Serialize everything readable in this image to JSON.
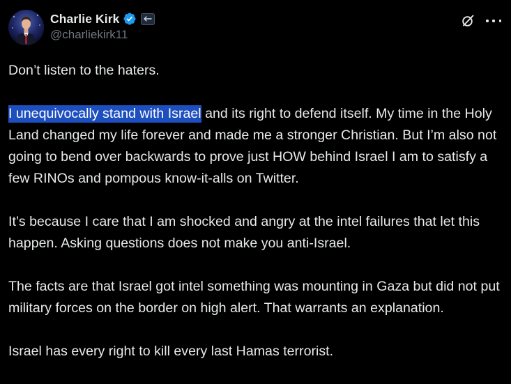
{
  "author": {
    "display_name": "Charlie Kirk",
    "handle": "@charliekirk11",
    "verified": true,
    "avatar_icon": "profile-photo",
    "badge_icon": "affiliate-badge"
  },
  "header_actions": {
    "grok_icon": "grok-icon",
    "more_icon": "more-icon"
  },
  "colors": {
    "background": "#000000",
    "text": "#e7e9ea",
    "secondary_text": "#71767b",
    "verified_blue": "#1d9bf0",
    "selection_highlight": "#1d4fbf"
  },
  "tweet": {
    "p1": "Don’t listen to the haters.",
    "p2_highlight": "I unequivocally stand with Israel",
    "p2_rest": " and its right to defend itself. My time in the Holy Land changed my life forever and made me a stronger Christian. But I’m also not going to bend over backwards to prove just HOW behind Israel I am to satisfy a few RINOs and pompous know-it-alls on Twitter.",
    "p3": "It’s because I care that I am shocked and angry at the intel failures that let this happen. Asking questions does not make you anti-Israel.",
    "p4": "The facts are that Israel got intel something was mounting in Gaza but did not put military forces on the border on high alert. That warrants an explanation.",
    "p5": "Israel has every right to kill every last Hamas terrorist."
  }
}
